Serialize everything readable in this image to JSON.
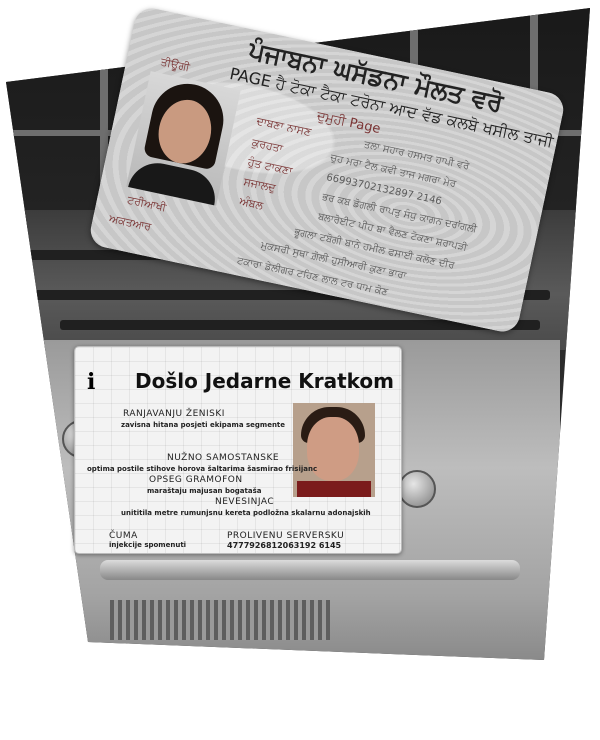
{
  "card_punjabi": {
    "title": "ਪੰਜਾਬਨਾ ਘਸੱਡਨਾ ਮੌਲਤ ਵਰੋ",
    "subtitle": "PAGE ਹੈ ਟੋਕਾ ਟੈਕਾ ਟਰੋਨਾ ਆਦ ਵੱਡ ਕਲਬੋ ਖਸੀਲ ਤਾਜੀ",
    "label_1": "ਤੀਊਗੀ",
    "label_2": "ਦੁਮੁਹੀ Page",
    "label_3": "ਦਾਬਣਾ ਨਾਸਣ",
    "label_4": "ਕੁਰਹਤਾ",
    "label_5": "ਹੁੰਤ ਟਾਕਣਾ",
    "label_6": "ਸਜਾਲਦੁ",
    "label_7": "ਅੰਬਲ",
    "label_8": "ਟਰੀਆਖੀ",
    "label_9": "ਅਕਤਆਰ",
    "value_1": "ਤਲਾ ਸਹਾਰ ਹਸਮਤ ਹਾਪੀ ਵਰੇ",
    "value_2": "ਚੁਹ ਮਰਾ ਟੈਲ ਕਵੀ ਤਾਜ ਮਗਰਾ ਮੇਰ",
    "number": "66993702132897 2146",
    "value_4": "ਭਰ ਕਬ ਡੋਗਲੀ ਰਾਪਤੁ ਸੰਧੁ ਕਾਗਨ ਦਰਾਂਗਲੀ",
    "value_5": "ਬਲਾਰੋਈਟ ਪੀਹ ਬਾ ਵੈਲਣ ਟੋਕਣਾ ਸ਼ਰਾਪੜੀ",
    "value_6": "ਭੂਗਲਾ ਟਬੋਗੀ ਬਾਨੇ ਹਮੀਲ ਫਸਾਈ ਕਲੋਣ ਦੀਰ",
    "value_7": "ਮੁਕਸਰੀ ਸੁਥਾ ਗ਼ੋਲੀ ਹੁਸੀਆਰੀ ਕੁਣਾ ਭਾਰਾ",
    "value_8": "ਟਕਾਰਾ ਡੇਲੀਗਰ ਟਹਿਣ ਲਾਲ ਟਰ ਧਾਮ ਕੋਣ"
  },
  "card_croatian": {
    "icon": "i",
    "title": "Došlo Jedarne Kratkom",
    "field1_label": "RANJAVANJU ŽENISKI",
    "field1_value": "zavisna hitana posjeti ekipama segmente",
    "field2_label": "NUŽNO SAMOSTANSKE",
    "field2_value": "optima postile stihove horova šaltarima šasmirao frisijanc",
    "field3_label": "OPSEG GRAMOFON",
    "field3_value": "maraštaju majusan bogatašа",
    "field4_label": "NEVESINJAC",
    "field4_value": "unititila metre rumunjsnu kereta podložna skalarnu adonajskih",
    "field5_label": "ČUMA",
    "field5_value": "injekcije spomenuti",
    "field6_label": "PROLIVENU SERVERSKU",
    "field6_value": "4777926812063192 6145"
  }
}
